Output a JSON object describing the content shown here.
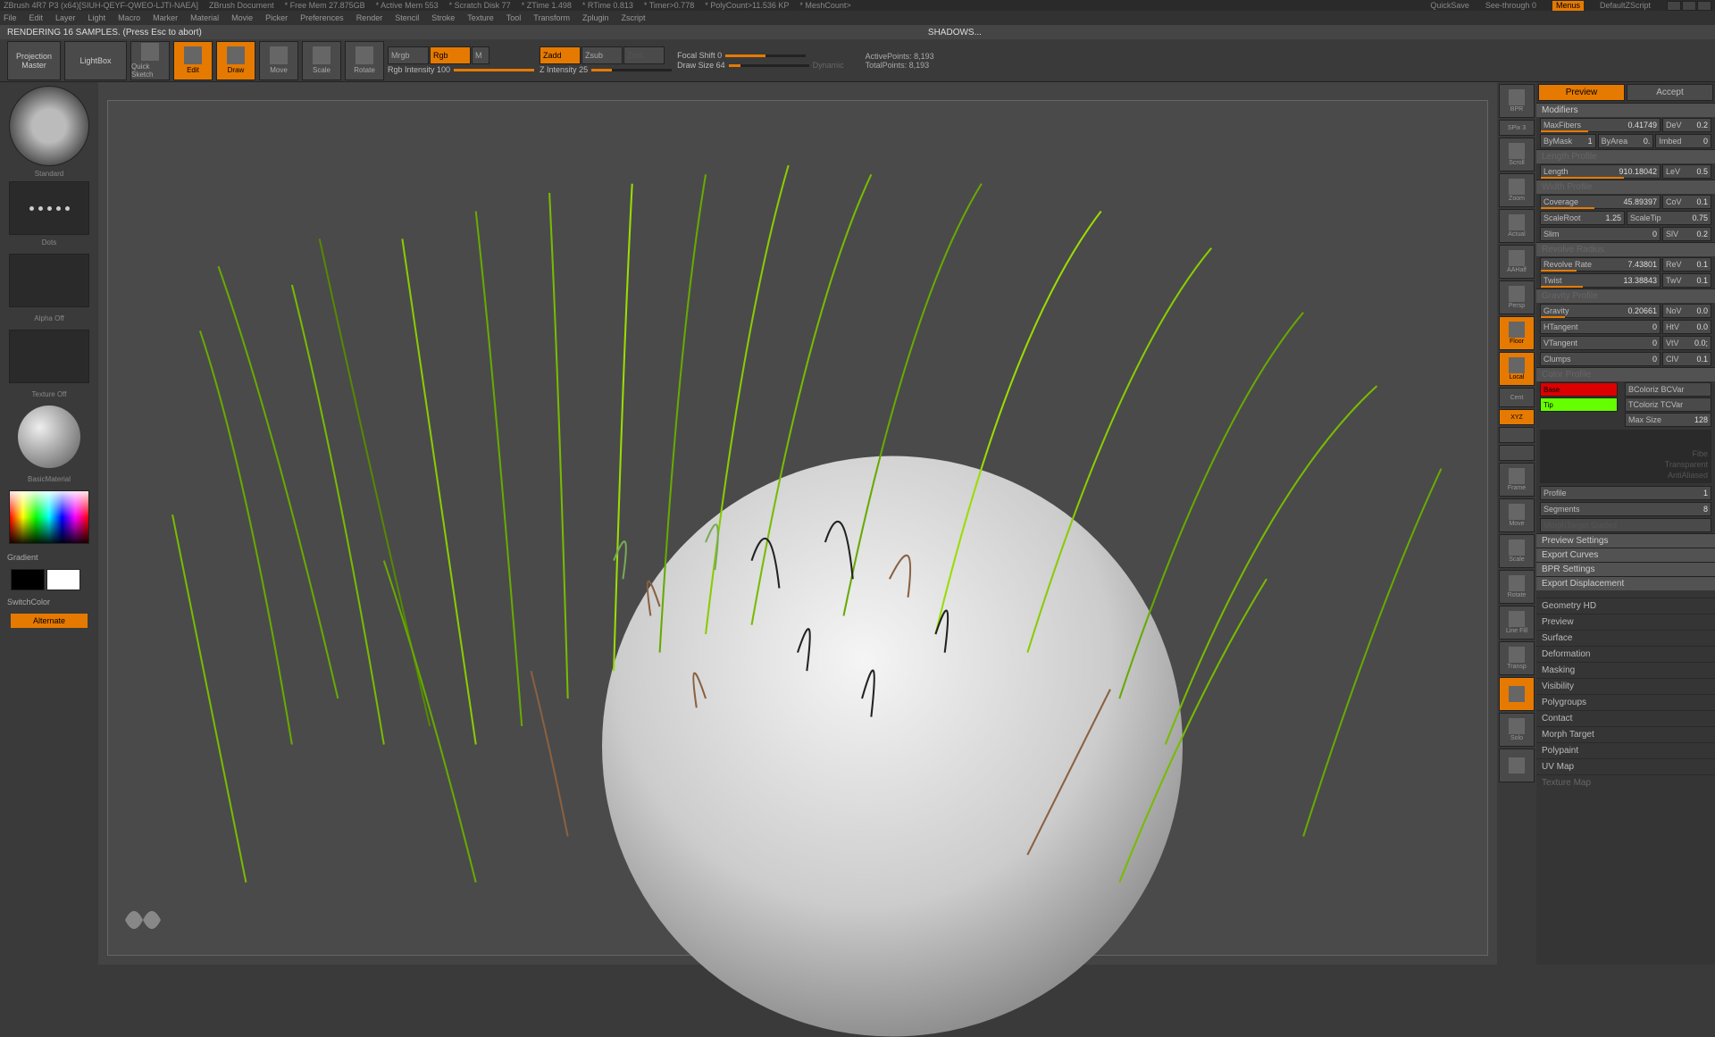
{
  "title": {
    "app": "ZBrush 4R7 P3 (x64)[SIUH-QEYF-QWEO-LJTI-NAEA]",
    "doc": "ZBrush Document",
    "freemem": "* Free Mem 27.875GB",
    "activemem": "* Active Mem 553",
    "scratch": "* Scratch Disk 77",
    "ztime": "* ZTime 1.498",
    "rtime": "* RTime 0.813",
    "timer": "* Timer>0.778",
    "polycount": "* PolyCount>11.536 KP",
    "meshcount": "* MeshCount>",
    "quicksave": "QuickSave",
    "seethrough": "See-through  0",
    "menus": "Menus",
    "defaultscript": "DefaultZScript"
  },
  "menu": [
    "File",
    "Edit",
    "Layer",
    "Light",
    "Macro",
    "Marker",
    "Material",
    "Movie",
    "Picker",
    "Preferences",
    "Render",
    "Stencil",
    "Stroke",
    "Texture",
    "Tool",
    "Transform",
    "Zplugin",
    "Zscript"
  ],
  "status": {
    "msg": "RENDERING 16 SAMPLES. (Press Esc to abort)",
    "center": "SHADOWS..."
  },
  "toolbar": {
    "projection": "Projection Master",
    "lightbox": "LightBox",
    "quicksketch": "Quick Sketch",
    "edit": "Edit",
    "draw": "Draw",
    "move": "Move",
    "scale": "Scale",
    "rotate": "Rotate",
    "mrgb": "Mrgb",
    "rgb": "Rgb",
    "m": "M",
    "rgbint": "Rgb Intensity 100",
    "zadd": "Zadd",
    "zsub": "Zsub",
    "zcut": "Zcut",
    "zint": "Z Intensity 25",
    "focal": "Focal Shift 0",
    "drawsize": "Draw Size 64",
    "dynamic": "Dynamic",
    "active": "ActivePoints: 8,193",
    "total": "TotalPoints: 8,193"
  },
  "left": {
    "brush": "Standard",
    "stroke": "Dots",
    "alpha": "Alpha Off",
    "texture": "Texture Off",
    "material": "BasicMaterial",
    "gradient": "Gradient",
    "switch": "SwitchColor",
    "alternate": "Alternate"
  },
  "rightTools": [
    "BPR",
    "SPix 3",
    "Scroll",
    "Zoom",
    "Actual",
    "AAHalf",
    "Persp",
    "Floor",
    "Local",
    "Cent",
    "XYZ",
    "",
    "",
    "Frame",
    "Move",
    "Scale",
    "Rotate",
    "Line Fill",
    "Transp",
    "",
    "Solo",
    ""
  ],
  "panel": {
    "preview": "Preview",
    "accept": "Accept",
    "modifiers": "Modifiers",
    "maxfibers": {
      "l": "MaxFibers",
      "v": "0.41749"
    },
    "dev": {
      "l": "DeV",
      "v": "0.2"
    },
    "bymask": {
      "l": "ByMask",
      "v": "1"
    },
    "byarea": {
      "l": "ByArea",
      "v": "0."
    },
    "imbed": {
      "l": "Imbed",
      "v": "0"
    },
    "lengthprof": "Length Profile",
    "length": {
      "l": "Length",
      "v": "910.18042"
    },
    "lev": {
      "l": "LeV",
      "v": "0.5"
    },
    "widthprof": "Width Profile",
    "coverage": {
      "l": "Coverage",
      "v": "45.89397"
    },
    "cov": {
      "l": "CoV",
      "v": "0.1"
    },
    "scaleroot": {
      "l": "ScaleRoot",
      "v": "1.25"
    },
    "scaletip": {
      "l": "ScaleTip",
      "v": "0.75"
    },
    "slim": {
      "l": "Slim",
      "v": "0"
    },
    "slv": {
      "l": "SlV",
      "v": "0.2"
    },
    "revolve": "Revolve Radius",
    "revrate": {
      "l": "Revolve Rate",
      "v": "7.43801"
    },
    "rev": {
      "l": "ReV",
      "v": "0.1"
    },
    "twist": {
      "l": "Twist",
      "v": "13.38843"
    },
    "twv": {
      "l": "TwV",
      "v": "0.1"
    },
    "gravprof": "Gravity Profile",
    "gravity": {
      "l": "Gravity",
      "v": "0.20661"
    },
    "nov": {
      "l": "NoV",
      "v": "0.0"
    },
    "htan": {
      "l": "HTangent",
      "v": "0"
    },
    "htv": {
      "l": "HtV",
      "v": "0.0"
    },
    "vtan": {
      "l": "VTangent",
      "v": "0"
    },
    "vtv": {
      "l": "VtV",
      "v": "0.0;"
    },
    "clumps": {
      "l": "Clumps",
      "v": "0"
    },
    "clv": {
      "l": "ClV",
      "v": "0.1"
    },
    "colorprof": "Color Profile",
    "base": "Base",
    "tip": "Tip",
    "bcolor": "BColoriz BCVar",
    "tcolor": "TColoriz TCVar",
    "maxsize": {
      "l": "Max Size",
      "v": "128"
    },
    "fibe": "Fibe",
    "trans": "Transparent",
    "aa": "AntiAliased",
    "profile1": {
      "l": "Profile",
      "v": "1"
    },
    "segments": {
      "l": "Segments",
      "v": "8"
    },
    "morph": "MorphTarget Guided",
    "previewset": "Preview Settings",
    "exportcurves": "Export Curves",
    "bprset": "BPR Settings",
    "exportdisp": "Export Displacement",
    "geo": "Geometry HD",
    "prev": "Preview",
    "surf": "Surface",
    "deform": "Deformation",
    "mask": "Masking",
    "vis": "Visibility",
    "poly": "Polygroups",
    "contact": "Contact",
    "morpht": "Morph Target",
    "polypaint": "Polypaint",
    "uv": "UV Map",
    "texmap": "Texture Map"
  }
}
